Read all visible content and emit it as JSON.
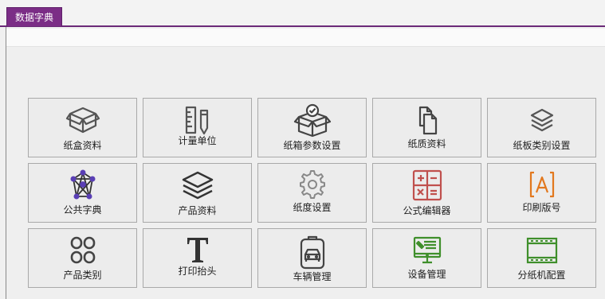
{
  "tab": {
    "label": "数据字典"
  },
  "tiles": [
    {
      "label": "纸盒资料",
      "icon": "box-icon"
    },
    {
      "label": "计量单位",
      "icon": "ruler-pencil-icon"
    },
    {
      "label": "纸箱参数设置",
      "icon": "box-check-icon"
    },
    {
      "label": "纸质资料",
      "icon": "documents-icon"
    },
    {
      "label": "纸板类别设置",
      "icon": "layers-icon"
    },
    {
      "label": "公共字典",
      "icon": "network-star-icon"
    },
    {
      "label": "产品资料",
      "icon": "stack-icon"
    },
    {
      "label": "纸度设置",
      "icon": "gear-icon"
    },
    {
      "label": "公式编辑器",
      "icon": "calculator-icon"
    },
    {
      "label": "印刷版号",
      "icon": "text-box-a-icon"
    },
    {
      "label": "产品类别",
      "icon": "grid-rounded-icon"
    },
    {
      "label": "打印抬头",
      "icon": "font-t-icon"
    },
    {
      "label": "车辆管理",
      "icon": "vehicle-badge-icon"
    },
    {
      "label": "设备管理",
      "icon": "monitor-tools-icon"
    },
    {
      "label": "分纸机配置",
      "icon": "film-strip-icon"
    }
  ],
  "colors": {
    "accent": "#7b2d86",
    "icon_gray": "#555555",
    "icon_red": "#c0504d",
    "icon_orange": "#e2781e",
    "icon_green": "#3f8f2b",
    "icon_purple": "#5a3fb5"
  }
}
